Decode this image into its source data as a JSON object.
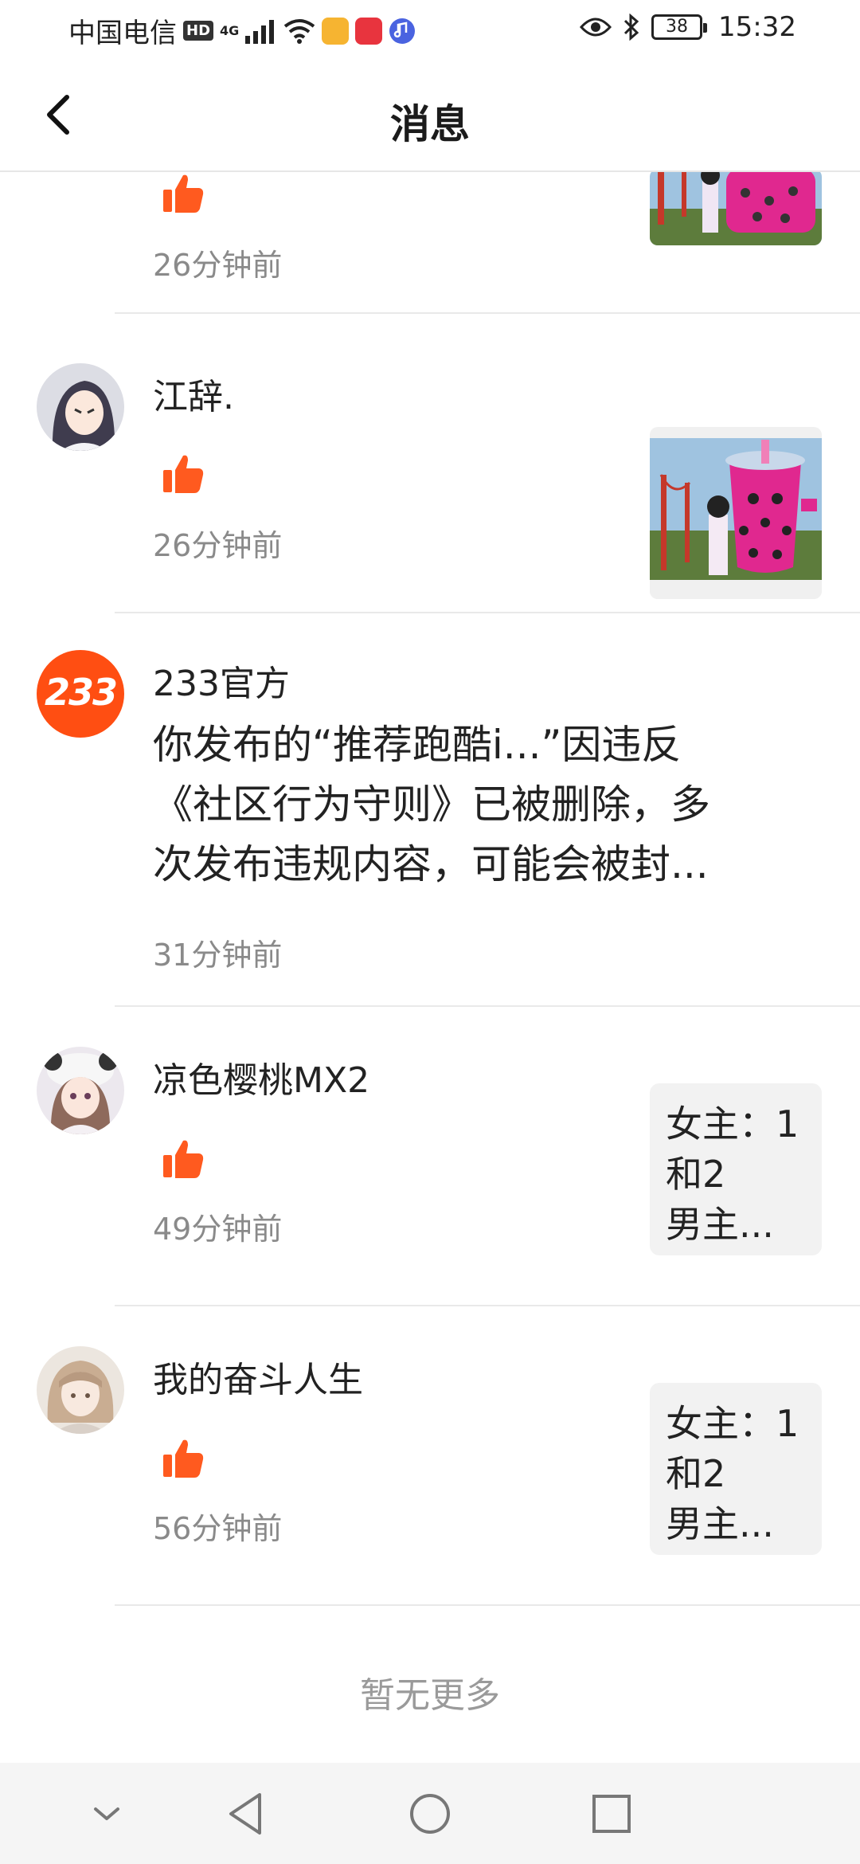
{
  "status_bar": {
    "carrier": "中国电信",
    "hd_badge": "HD",
    "network": "4G",
    "battery": "38",
    "time": "15:32",
    "icons": [
      "signal-icon",
      "wifi-icon",
      "app-icon-orange",
      "app-icon-huawei",
      "music-icon",
      "eye-icon",
      "bluetooth-icon",
      "battery-icon"
    ]
  },
  "header": {
    "title": "消息",
    "back_icon": "chevron-left-icon"
  },
  "messages": [
    {
      "type": "like",
      "time": "26分钟前",
      "has_thumb": true
    },
    {
      "type": "like",
      "name": "江辞.",
      "time": "26分钟前",
      "has_thumb": true
    },
    {
      "type": "system",
      "name": "233官方",
      "avatar_text": "233",
      "lines": [
        "你发布的“推荐跑酷i...”因违反",
        "《社区行为守则》已被删除，多",
        "次发布违规内容，可能会被封..."
      ],
      "time": "31分钟前"
    },
    {
      "type": "like",
      "name": "凉色樱桃MX2",
      "time": "49分钟前",
      "card_lines": [
        "女主：1",
        "和2",
        "男主..."
      ]
    },
    {
      "type": "like",
      "name": "我的奋斗人生",
      "time": "56分钟前",
      "card_lines": [
        "女主：1",
        "和2",
        "男主..."
      ]
    }
  ],
  "footer": {
    "no_more": "暂无更多"
  },
  "nav_bar": [
    "collapse-icon",
    "back-triangle-icon",
    "home-circle-icon",
    "recents-square-icon"
  ],
  "colors": {
    "like": "#ff5a1f",
    "official": "#ff4e12",
    "time": "#8a8a8a"
  }
}
